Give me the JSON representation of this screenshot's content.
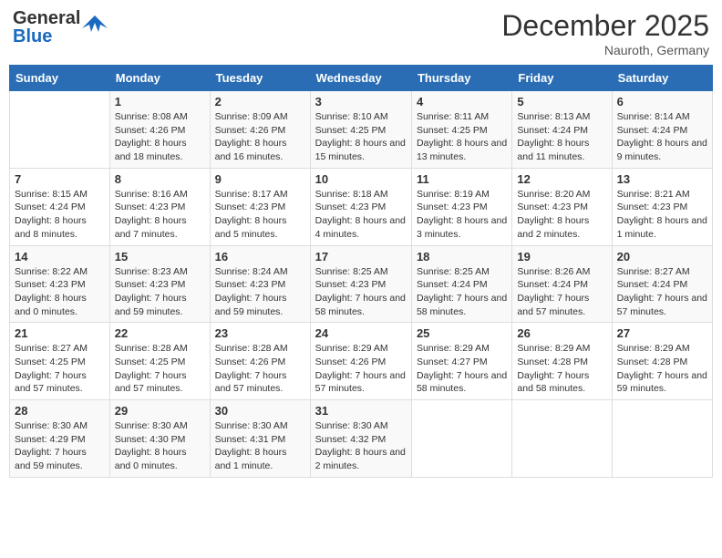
{
  "header": {
    "logo_general": "General",
    "logo_blue": "Blue",
    "month_year": "December 2025",
    "location": "Nauroth, Germany"
  },
  "days_of_week": [
    "Sunday",
    "Monday",
    "Tuesday",
    "Wednesday",
    "Thursday",
    "Friday",
    "Saturday"
  ],
  "weeks": [
    [
      {
        "day": "",
        "sunrise": "",
        "sunset": "",
        "daylight": ""
      },
      {
        "day": "1",
        "sunrise": "Sunrise: 8:08 AM",
        "sunset": "Sunset: 4:26 PM",
        "daylight": "Daylight: 8 hours and 18 minutes."
      },
      {
        "day": "2",
        "sunrise": "Sunrise: 8:09 AM",
        "sunset": "Sunset: 4:26 PM",
        "daylight": "Daylight: 8 hours and 16 minutes."
      },
      {
        "day": "3",
        "sunrise": "Sunrise: 8:10 AM",
        "sunset": "Sunset: 4:25 PM",
        "daylight": "Daylight: 8 hours and 15 minutes."
      },
      {
        "day": "4",
        "sunrise": "Sunrise: 8:11 AM",
        "sunset": "Sunset: 4:25 PM",
        "daylight": "Daylight: 8 hours and 13 minutes."
      },
      {
        "day": "5",
        "sunrise": "Sunrise: 8:13 AM",
        "sunset": "Sunset: 4:24 PM",
        "daylight": "Daylight: 8 hours and 11 minutes."
      },
      {
        "day": "6",
        "sunrise": "Sunrise: 8:14 AM",
        "sunset": "Sunset: 4:24 PM",
        "daylight": "Daylight: 8 hours and 9 minutes."
      }
    ],
    [
      {
        "day": "7",
        "sunrise": "Sunrise: 8:15 AM",
        "sunset": "Sunset: 4:24 PM",
        "daylight": "Daylight: 8 hours and 8 minutes."
      },
      {
        "day": "8",
        "sunrise": "Sunrise: 8:16 AM",
        "sunset": "Sunset: 4:23 PM",
        "daylight": "Daylight: 8 hours and 7 minutes."
      },
      {
        "day": "9",
        "sunrise": "Sunrise: 8:17 AM",
        "sunset": "Sunset: 4:23 PM",
        "daylight": "Daylight: 8 hours and 5 minutes."
      },
      {
        "day": "10",
        "sunrise": "Sunrise: 8:18 AM",
        "sunset": "Sunset: 4:23 PM",
        "daylight": "Daylight: 8 hours and 4 minutes."
      },
      {
        "day": "11",
        "sunrise": "Sunrise: 8:19 AM",
        "sunset": "Sunset: 4:23 PM",
        "daylight": "Daylight: 8 hours and 3 minutes."
      },
      {
        "day": "12",
        "sunrise": "Sunrise: 8:20 AM",
        "sunset": "Sunset: 4:23 PM",
        "daylight": "Daylight: 8 hours and 2 minutes."
      },
      {
        "day": "13",
        "sunrise": "Sunrise: 8:21 AM",
        "sunset": "Sunset: 4:23 PM",
        "daylight": "Daylight: 8 hours and 1 minute."
      }
    ],
    [
      {
        "day": "14",
        "sunrise": "Sunrise: 8:22 AM",
        "sunset": "Sunset: 4:23 PM",
        "daylight": "Daylight: 8 hours and 0 minutes."
      },
      {
        "day": "15",
        "sunrise": "Sunrise: 8:23 AM",
        "sunset": "Sunset: 4:23 PM",
        "daylight": "Daylight: 7 hours and 59 minutes."
      },
      {
        "day": "16",
        "sunrise": "Sunrise: 8:24 AM",
        "sunset": "Sunset: 4:23 PM",
        "daylight": "Daylight: 7 hours and 59 minutes."
      },
      {
        "day": "17",
        "sunrise": "Sunrise: 8:25 AM",
        "sunset": "Sunset: 4:23 PM",
        "daylight": "Daylight: 7 hours and 58 minutes."
      },
      {
        "day": "18",
        "sunrise": "Sunrise: 8:25 AM",
        "sunset": "Sunset: 4:24 PM",
        "daylight": "Daylight: 7 hours and 58 minutes."
      },
      {
        "day": "19",
        "sunrise": "Sunrise: 8:26 AM",
        "sunset": "Sunset: 4:24 PM",
        "daylight": "Daylight: 7 hours and 57 minutes."
      },
      {
        "day": "20",
        "sunrise": "Sunrise: 8:27 AM",
        "sunset": "Sunset: 4:24 PM",
        "daylight": "Daylight: 7 hours and 57 minutes."
      }
    ],
    [
      {
        "day": "21",
        "sunrise": "Sunrise: 8:27 AM",
        "sunset": "Sunset: 4:25 PM",
        "daylight": "Daylight: 7 hours and 57 minutes."
      },
      {
        "day": "22",
        "sunrise": "Sunrise: 8:28 AM",
        "sunset": "Sunset: 4:25 PM",
        "daylight": "Daylight: 7 hours and 57 minutes."
      },
      {
        "day": "23",
        "sunrise": "Sunrise: 8:28 AM",
        "sunset": "Sunset: 4:26 PM",
        "daylight": "Daylight: 7 hours and 57 minutes."
      },
      {
        "day": "24",
        "sunrise": "Sunrise: 8:29 AM",
        "sunset": "Sunset: 4:26 PM",
        "daylight": "Daylight: 7 hours and 57 minutes."
      },
      {
        "day": "25",
        "sunrise": "Sunrise: 8:29 AM",
        "sunset": "Sunset: 4:27 PM",
        "daylight": "Daylight: 7 hours and 58 minutes."
      },
      {
        "day": "26",
        "sunrise": "Sunrise: 8:29 AM",
        "sunset": "Sunset: 4:28 PM",
        "daylight": "Daylight: 7 hours and 58 minutes."
      },
      {
        "day": "27",
        "sunrise": "Sunrise: 8:29 AM",
        "sunset": "Sunset: 4:28 PM",
        "daylight": "Daylight: 7 hours and 59 minutes."
      }
    ],
    [
      {
        "day": "28",
        "sunrise": "Sunrise: 8:30 AM",
        "sunset": "Sunset: 4:29 PM",
        "daylight": "Daylight: 7 hours and 59 minutes."
      },
      {
        "day": "29",
        "sunrise": "Sunrise: 8:30 AM",
        "sunset": "Sunset: 4:30 PM",
        "daylight": "Daylight: 8 hours and 0 minutes."
      },
      {
        "day": "30",
        "sunrise": "Sunrise: 8:30 AM",
        "sunset": "Sunset: 4:31 PM",
        "daylight": "Daylight: 8 hours and 1 minute."
      },
      {
        "day": "31",
        "sunrise": "Sunrise: 8:30 AM",
        "sunset": "Sunset: 4:32 PM",
        "daylight": "Daylight: 8 hours and 2 minutes."
      },
      {
        "day": "",
        "sunrise": "",
        "sunset": "",
        "daylight": ""
      },
      {
        "day": "",
        "sunrise": "",
        "sunset": "",
        "daylight": ""
      },
      {
        "day": "",
        "sunrise": "",
        "sunset": "",
        "daylight": ""
      }
    ]
  ]
}
